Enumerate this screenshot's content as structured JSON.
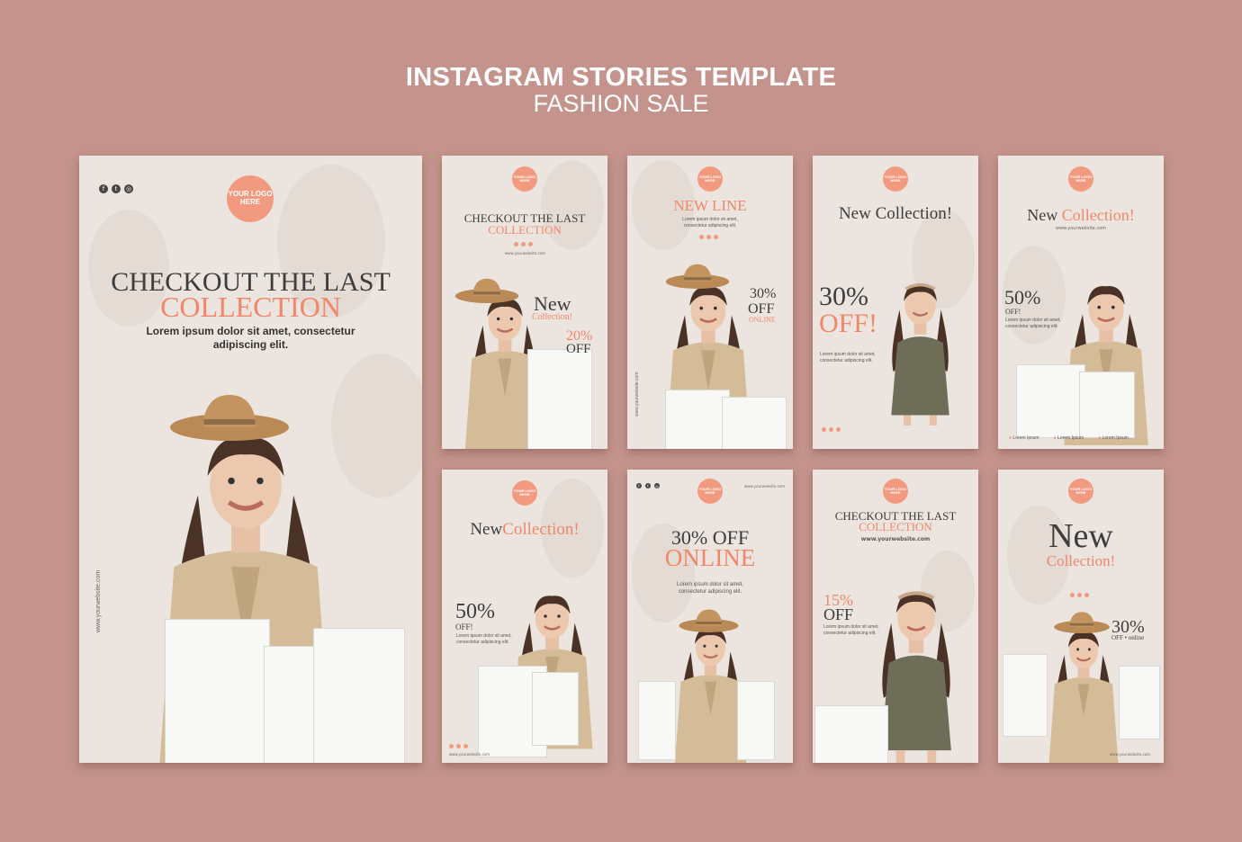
{
  "header": {
    "title": "INSTAGRAM STORIES TEMPLATE",
    "subtitle": "FASHION SALE"
  },
  "colors": {
    "background": "#c4948c",
    "card": "#ece5df",
    "accent": "#f0876a",
    "text_dark": "#3d3d3d"
  },
  "logo_text": "YOUR LOGO\nHERE",
  "website": "www.yourwebsite.com",
  "lorem_short": "Lorem ipsum dolor sit amet,\nconsectetur adipiscing elit.",
  "lorem_item": "Lorem Ipsum",
  "social_icons": [
    "facebook-icon",
    "twitter-icon",
    "instagram-icon"
  ],
  "main_story": {
    "headline": "CHECKOUT THE LAST",
    "headline_accent": "COLLECTION",
    "body": "Lorem ipsum dolor sit amet, consectetur\nadipiscing elit.",
    "website": "www.yourwebsite.com"
  },
  "stories": [
    {
      "title": "CHECKOUT THE LAST",
      "title_accent": "COLLECTION",
      "promo_word": "New",
      "promo_sub": "Collection!",
      "discount": "20%",
      "discount_word": "OFF"
    },
    {
      "title": "NEW LINE",
      "discount": "30%",
      "discount_word": "OFF",
      "discount_sub": "ONLINE"
    },
    {
      "title": "New Collection!",
      "discount": "30%",
      "discount_word": "OFF!"
    },
    {
      "title": "New ",
      "title_accent": "Collection!",
      "discount": "50%",
      "discount_word": "OFF!"
    },
    {
      "title": "New",
      "title_accent": "Collection!",
      "discount": "50%",
      "discount_word": "OFF!"
    },
    {
      "title": "30% OFF",
      "title_accent": "ONLINE"
    },
    {
      "title": "CHECKOUT THE LAST",
      "title_accent": "COLLECTION",
      "discount": "15%",
      "discount_word": "OFF"
    },
    {
      "title": "New",
      "title_accent": "Collection!",
      "discount": "30%",
      "discount_word": "OFF • online"
    }
  ]
}
